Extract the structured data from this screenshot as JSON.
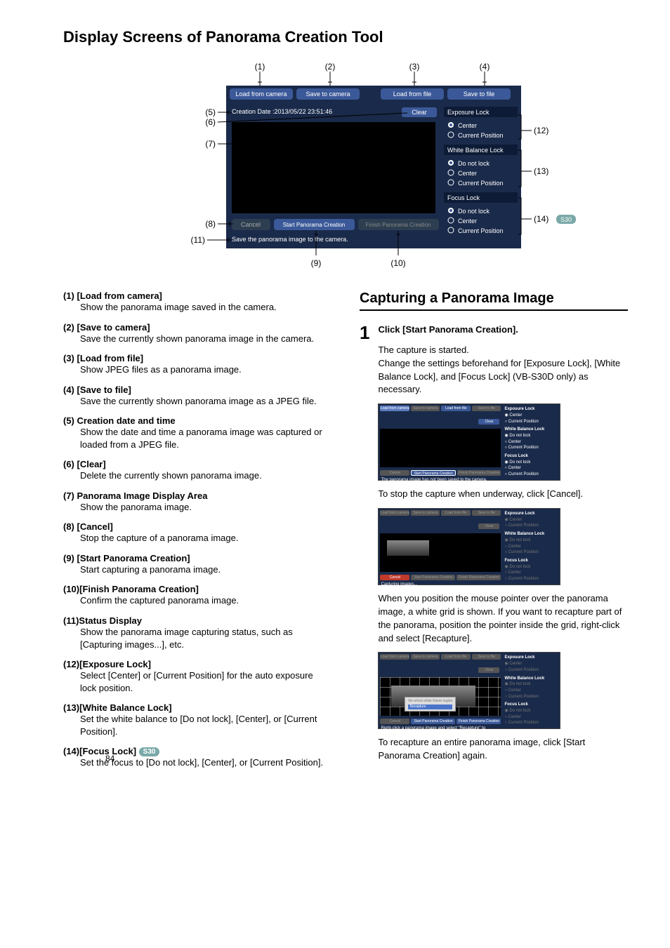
{
  "page_number": "84",
  "main_heading": "Display Screens of Panorama Creation Tool",
  "diagram": {
    "callouts": [
      "(1)",
      "(2)",
      "(3)",
      "(4)",
      "(5)",
      "(6)",
      "(7)",
      "(8)",
      "(9)",
      "(10)",
      "(11)",
      "(12)",
      "(13)",
      "(14)"
    ],
    "buttons": {
      "load_from_camera": "Load from camera",
      "save_to_camera": "Save to camera",
      "load_from_file": "Load from file",
      "save_to_file": "Save to file",
      "clear": "Clear",
      "cancel": "Cancel",
      "start_panorama_creation": "Start Panorama Creation",
      "finish_panorama_creation": "Finish Panorama Creation"
    },
    "creation_date": "Creation Date :2013/05/22 23:51:46",
    "status_msg": "Save the panorama image to the camera.",
    "exposure_lock": {
      "title": "Exposure Lock",
      "opts": [
        "Center",
        "Current Position"
      ]
    },
    "white_balance_lock": {
      "title": "White Balance Lock",
      "opts": [
        "Do not lock",
        "Center",
        "Current Position"
      ]
    },
    "focus_lock": {
      "title": "Focus Lock",
      "opts": [
        "Do not lock",
        "Center",
        "Current Position"
      ]
    },
    "badge_14": "S30"
  },
  "defs": [
    {
      "num": "(1)",
      "label": "[Load from camera]",
      "body": "Show the panorama image saved in the camera."
    },
    {
      "num": "(2)",
      "label": "[Save to camera]",
      "body": "Save the currently shown panorama image in the camera."
    },
    {
      "num": "(3)",
      "label": "[Load from file]",
      "body": "Show JPEG files as a panorama image."
    },
    {
      "num": "(4)",
      "label": "[Save to file]",
      "body": "Save the currently shown panorama image as a JPEG file."
    },
    {
      "num": "(5)",
      "label": "Creation date and time",
      "body": "Show the date and time a panorama image was captured or loaded from a JPEG file."
    },
    {
      "num": "(6)",
      "label": "[Clear]",
      "body": "Delete the currently shown panorama image."
    },
    {
      "num": "(7)",
      "label": "Panorama Image Display Area",
      "body": "Show the panorama image."
    },
    {
      "num": "(8)",
      "label": "[Cancel]",
      "body": "Stop the capture of a panorama image."
    },
    {
      "num": "(9)",
      "label": "[Start Panorama Creation]",
      "body": "Start capturing a panorama image."
    },
    {
      "num": "(10)",
      "label": "[Finish Panorama Creation]",
      "body": "Confirm the captured panorama image."
    },
    {
      "num": "(11)",
      "label": "Status Display",
      "body": "Show the panorama image capturing status, such as [Capturing images...], etc."
    },
    {
      "num": "(12)",
      "label": "[Exposure Lock]",
      "body": "Select [Center] or [Current Position] for the auto exposure lock position."
    },
    {
      "num": "(13)",
      "label": "[White Balance Lock]",
      "body": "Set the white balance to [Do not lock], [Center], or [Current Position]."
    },
    {
      "num": "(14)",
      "label": "[Focus Lock]",
      "body": "Set the focus to [Do not lock], [Center], or [Current Position].",
      "badge": "S30"
    }
  ],
  "right": {
    "heading": "Capturing a Panorama Image",
    "step_num": "1",
    "step_title": "Click [Start Panorama Creation].",
    "p1": "The capture is started.",
    "p2": "Change the settings beforehand for [Exposure Lock], [White Balance Lock], and [Focus Lock] (VB-S30D only) as necessary.",
    "p3": "To stop the capture when underway, click [Cancel].",
    "p4": "When you position the mouse pointer over the panorama image, a white grid is shown. If you want to recapture part of the panorama, position the pointer inside the grid, right-click and select [Recapture].",
    "p5": "To recapture an entire panorama image, click [Start Panorama Creation] again.",
    "shot1_status": "The panorama image has not been saved to the camera.",
    "shot2_status": "Capturing images...",
    "shot3_status": "Right-click a panorama image and select \"Recapture\" to recapture that part of it.",
    "shot3_menu1": "Re-shoot white frame region",
    "shot3_menu2": "Recapture",
    "side_panel": {
      "exposure": "Exposure Lock",
      "wb": "White Balance Lock",
      "focus": "Focus Lock",
      "center": "Center",
      "curpos": "Current Position",
      "dnl": "Do not lock"
    },
    "topbtns": [
      "Load from camera",
      "Save to camera",
      "Load from file",
      "Save to file"
    ],
    "botbtns": [
      "Cancel",
      "Start Panorama Creation",
      "Finish Panorama Creation"
    ],
    "clear": "Clear"
  }
}
